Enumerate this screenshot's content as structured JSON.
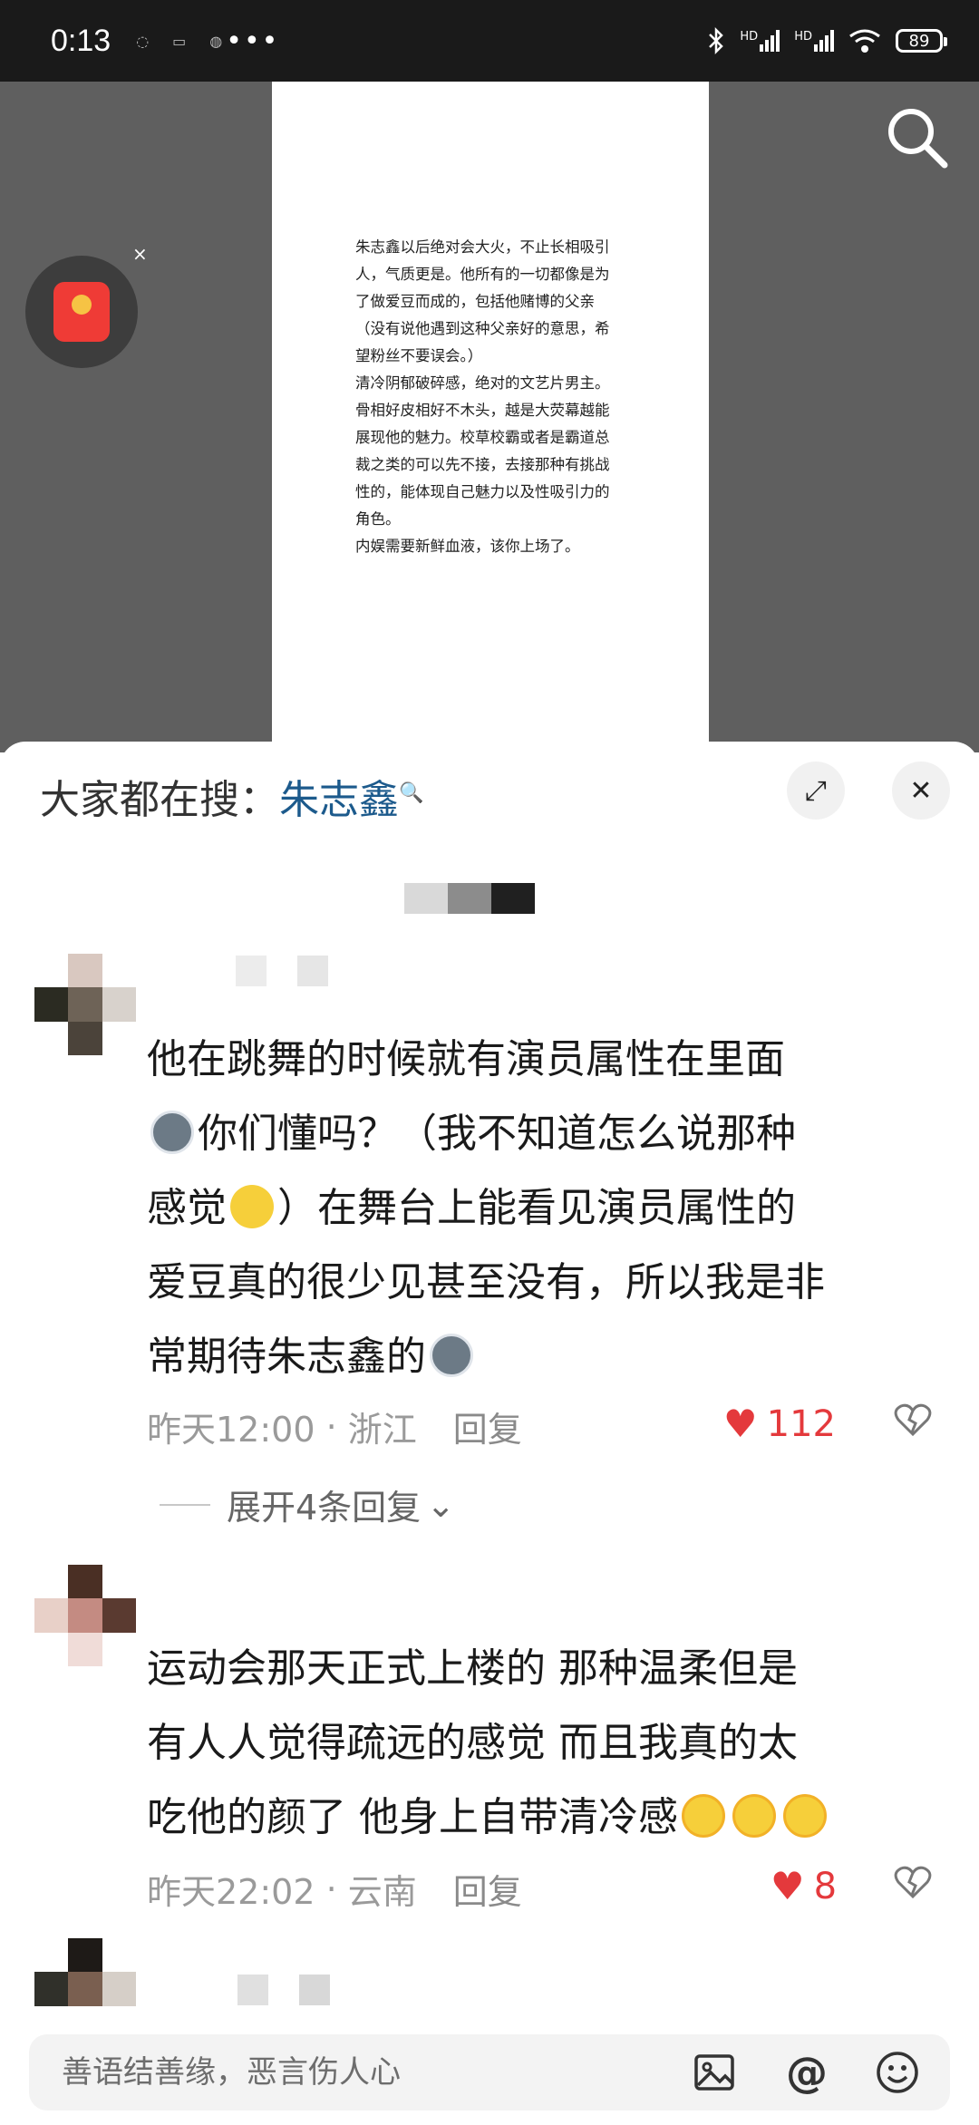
{
  "status_bar": {
    "time": "0:13",
    "notification_icons": [
      "chat-icon",
      "message-icon",
      "app-icon"
    ],
    "more": "•••",
    "signal_label_1": "HD",
    "signal_label_2": "HD",
    "battery": "89"
  },
  "doc": {
    "text": "朱志鑫以后绝对会大火，不止长相吸引\n人，气质更是。他所有的一切都像是为\n了做爱豆而成的，包括他赌博的父亲\n（没有说他遇到这种父亲好的意思，希\n望粉丝不要误会。）\n清冷阴郁破碎感，绝对的文艺片男主。\n骨相好皮相好不木头，越是大荧幕越能\n展现他的魅力。校草校霸或者是霸道总\n裁之类的可以先不接，去接那种有挑战\n性的，能体现自己魅力以及性吸引力的\n角色。\n内娱需要新鲜血液，该你上场了。"
  },
  "floating": {
    "close": "×"
  },
  "sheet": {
    "header_prefix": "大家都在搜：",
    "header_term": "朱志鑫",
    "header_search_glyph": "🔍",
    "expand_glyph": "⤢",
    "close_glyph": "✕"
  },
  "comments": [
    {
      "text_1": "他在跳舞的时候就有演员属性在里面",
      "text_2": "你们懂吗？（我不知道怎么说那种",
      "text_3a": "感觉",
      "text_3b": "）在舞台上能看见演员属性的",
      "text_4": "爱豆真的很少见甚至没有，所以我是非",
      "text_5": "常期待朱志鑫的",
      "time": "昨天12:00",
      "location": "浙江",
      "reply": "回复",
      "likes": "112",
      "expand": "展开4条回复"
    },
    {
      "text_1": "运动会那天正式上楼的 那种温柔但是",
      "text_2": "有人人觉得疏远的感觉 而且我真的太",
      "text_3": "吃他的颜了 他身上自带清冷感",
      "time": "昨天22:02",
      "location": "云南",
      "reply": "回复",
      "likes": "8"
    }
  ],
  "input": {
    "placeholder": "善语结善缘，恶言伤人心"
  },
  "colors": {
    "accent_link": "#1c5a8c",
    "like_red": "#e4393c",
    "status_bg": "#1a1a1a"
  }
}
